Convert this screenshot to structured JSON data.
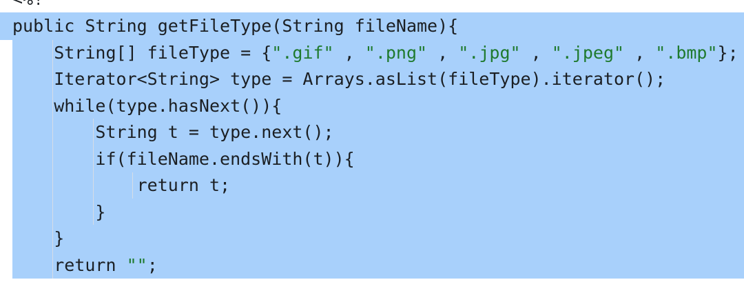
{
  "top_fragment": "<%!",
  "code_lines": [
    {
      "parts": [
        {
          "text": "public String getFileType(String fileName){",
          "cls": ""
        }
      ]
    },
    {
      "parts": [
        {
          "text": "    String[] fileType = {",
          "cls": ""
        },
        {
          "text": "\".gif\"",
          "cls": "str"
        },
        {
          "text": " , ",
          "cls": ""
        },
        {
          "text": "\".png\"",
          "cls": "str"
        },
        {
          "text": " , ",
          "cls": ""
        },
        {
          "text": "\".jpg\"",
          "cls": "str"
        },
        {
          "text": " , ",
          "cls": ""
        },
        {
          "text": "\".jpeg\"",
          "cls": "str"
        },
        {
          "text": " , ",
          "cls": ""
        },
        {
          "text": "\".bmp\"",
          "cls": "str"
        },
        {
          "text": "};",
          "cls": ""
        }
      ]
    },
    {
      "parts": [
        {
          "text": "    Iterator<String> type = Arrays.asList(fileType).iterator();",
          "cls": ""
        }
      ]
    },
    {
      "parts": [
        {
          "text": "    while(type.hasNext()){",
          "cls": ""
        }
      ]
    },
    {
      "parts": [
        {
          "text": "        String t = type.next();",
          "cls": ""
        }
      ]
    },
    {
      "parts": [
        {
          "text": "        if(fileName.endsWith(t)){",
          "cls": ""
        }
      ]
    },
    {
      "parts": [
        {
          "text": "            return t;",
          "cls": ""
        }
      ]
    },
    {
      "parts": [
        {
          "text": "        }",
          "cls": ""
        }
      ]
    },
    {
      "parts": [
        {
          "text": "    }",
          "cls": ""
        }
      ]
    },
    {
      "parts": [
        {
          "text": "    return ",
          "cls": ""
        },
        {
          "text": "\"\"",
          "cls": "str"
        },
        {
          "text": ";",
          "cls": ""
        }
      ]
    }
  ],
  "colors": {
    "selection": "#a8d0fb",
    "string_literal": "#1f7a2e",
    "text": "#1b1f23",
    "indent_guide": "#d6dde6"
  }
}
